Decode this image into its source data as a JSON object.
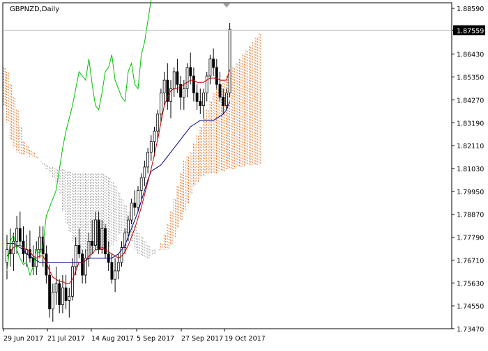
{
  "symbol_label": "GBPNZD,Daily",
  "current_price": "1.87559",
  "colors": {
    "background": "#ffffff",
    "frame": "#000000",
    "tenkan": "#c00000",
    "kijun": "#000080",
    "chikou": "#00c000",
    "cloud_bear": "#e07020",
    "cloud_bull": "#a0a0a0",
    "price_tag_bg": "#000000",
    "price_tag_fg": "#ffffff",
    "price_line": "#c0c0c0"
  },
  "chart_data": {
    "type": "candlestick",
    "title": "GBPNZD,Daily",
    "y_ticks": [
      "1.88590",
      "1.87559",
      "1.86430",
      "1.85350",
      "1.84270",
      "1.83190",
      "1.82110",
      "1.81030",
      "1.79950",
      "1.78870",
      "1.77790",
      "1.76710",
      "1.75630",
      "1.74550",
      "1.73470"
    ],
    "x_ticks": [
      "29 Jun 2017",
      "21 Jul 2017",
      "14 Aug 2017",
      "5 Sep 2017",
      "27 Sep 2017",
      "19 Oct 2017"
    ],
    "ylim": [
      1.7347,
      1.8859
    ],
    "price_step": 0.0108,
    "candles": [
      [
        1.766,
        1.779,
        1.758,
        1.772
      ],
      [
        1.772,
        1.782,
        1.764,
        1.77
      ],
      [
        1.77,
        1.78,
        1.762,
        1.776
      ],
      [
        1.776,
        1.788,
        1.77,
        1.782
      ],
      [
        1.782,
        1.79,
        1.774,
        1.776
      ],
      [
        1.776,
        1.783,
        1.766,
        1.77
      ],
      [
        1.77,
        1.779,
        1.764,
        1.772
      ],
      [
        1.772,
        1.781,
        1.766,
        1.768
      ],
      [
        1.768,
        1.774,
        1.76,
        1.764
      ],
      [
        1.764,
        1.776,
        1.76,
        1.772
      ],
      [
        1.772,
        1.783,
        1.768,
        1.778
      ],
      [
        1.778,
        1.783,
        1.764,
        1.77
      ],
      [
        1.77,
        1.774,
        1.756,
        1.76
      ],
      [
        1.76,
        1.765,
        1.74,
        1.744
      ],
      [
        1.744,
        1.756,
        1.738,
        1.752
      ],
      [
        1.752,
        1.764,
        1.746,
        1.756
      ],
      [
        1.756,
        1.758,
        1.742,
        1.746
      ],
      [
        1.746,
        1.76,
        1.742,
        1.754
      ],
      [
        1.754,
        1.76,
        1.744,
        1.748
      ],
      [
        1.748,
        1.754,
        1.74,
        1.75
      ],
      [
        1.75,
        1.768,
        1.748,
        1.764
      ],
      [
        1.764,
        1.778,
        1.76,
        1.774
      ],
      [
        1.774,
        1.782,
        1.768,
        1.77
      ],
      [
        1.77,
        1.772,
        1.756,
        1.76
      ],
      [
        1.76,
        1.772,
        1.756,
        1.768
      ],
      [
        1.768,
        1.78,
        1.764,
        1.776
      ],
      [
        1.776,
        1.786,
        1.77,
        1.774
      ],
      [
        1.774,
        1.79,
        1.772,
        1.786
      ],
      [
        1.786,
        1.79,
        1.77,
        1.772
      ],
      [
        1.772,
        1.786,
        1.77,
        1.782
      ],
      [
        1.782,
        1.784,
        1.768,
        1.77
      ],
      [
        1.77,
        1.776,
        1.762,
        1.766
      ],
      [
        1.766,
        1.77,
        1.756,
        1.758
      ],
      [
        1.758,
        1.768,
        1.752,
        1.762
      ],
      [
        1.762,
        1.77,
        1.758,
        1.766
      ],
      [
        1.766,
        1.776,
        1.764,
        1.773
      ],
      [
        1.773,
        1.782,
        1.77,
        1.78
      ],
      [
        1.78,
        1.788,
        1.776,
        1.786
      ],
      [
        1.786,
        1.796,
        1.784,
        1.794
      ],
      [
        1.794,
        1.8,
        1.788,
        1.792
      ],
      [
        1.792,
        1.802,
        1.79,
        1.8
      ],
      [
        1.8,
        1.808,
        1.796,
        1.806
      ],
      [
        1.806,
        1.814,
        1.802,
        1.811
      ],
      [
        1.811,
        1.82,
        1.808,
        1.818
      ],
      [
        1.818,
        1.826,
        1.814,
        1.823
      ],
      [
        1.823,
        1.83,
        1.816,
        1.828
      ],
      [
        1.828,
        1.838,
        1.824,
        1.836
      ],
      [
        1.836,
        1.848,
        1.832,
        1.846
      ],
      [
        1.846,
        1.856,
        1.84,
        1.852
      ],
      [
        1.852,
        1.86,
        1.838,
        1.842
      ],
      [
        1.842,
        1.852,
        1.834,
        1.848
      ],
      [
        1.848,
        1.858,
        1.844,
        1.856
      ],
      [
        1.856,
        1.862,
        1.846,
        1.85
      ],
      [
        1.85,
        1.854,
        1.838,
        1.844
      ],
      [
        1.844,
        1.852,
        1.838,
        1.848
      ],
      [
        1.848,
        1.86,
        1.844,
        1.858
      ],
      [
        1.858,
        1.865,
        1.85,
        1.854
      ],
      [
        1.854,
        1.858,
        1.842,
        1.846
      ],
      [
        1.846,
        1.85,
        1.838,
        1.842
      ],
      [
        1.842,
        1.848,
        1.836,
        1.84
      ],
      [
        1.84,
        1.848,
        1.834,
        1.846
      ],
      [
        1.846,
        1.856,
        1.842,
        1.854
      ],
      [
        1.854,
        1.864,
        1.85,
        1.862
      ],
      [
        1.862,
        1.867,
        1.854,
        1.858
      ],
      [
        1.858,
        1.862,
        1.848,
        1.85
      ],
      [
        1.85,
        1.856,
        1.842,
        1.844
      ],
      [
        1.844,
        1.848,
        1.836,
        1.84
      ],
      [
        1.84,
        1.848,
        1.838,
        1.846
      ],
      [
        1.846,
        1.879,
        1.844,
        1.876
      ]
    ],
    "tenkan": [
      1.769,
      1.771,
      1.773,
      1.774,
      1.774,
      1.773,
      1.772,
      1.771,
      1.769,
      1.768,
      1.769,
      1.769,
      1.766,
      1.762,
      1.759,
      1.758,
      1.757,
      1.757,
      1.756,
      1.756,
      1.758,
      1.762,
      1.766,
      1.766,
      1.767,
      1.769,
      1.77,
      1.772,
      1.772,
      1.773,
      1.772,
      1.771,
      1.77,
      1.769,
      1.768,
      1.769,
      1.771,
      1.774,
      1.778,
      1.782,
      1.787,
      1.792,
      1.798,
      1.804,
      1.81,
      1.817,
      1.824,
      1.832,
      1.84,
      1.844,
      1.847,
      1.848,
      1.848,
      1.849,
      1.85,
      1.851,
      1.852,
      1.852,
      1.851,
      1.851,
      1.851,
      1.852,
      1.853,
      1.853,
      1.853,
      1.852,
      1.852,
      1.852,
      1.857
    ],
    "kijun": [
      1.775,
      1.775,
      1.775,
      1.774,
      1.773,
      1.772,
      1.77,
      1.769,
      1.768,
      1.767,
      1.766,
      1.766,
      1.766,
      1.766,
      1.766,
      1.766,
      1.766,
      1.766,
      1.766,
      1.766,
      1.766,
      1.766,
      1.766,
      1.766,
      1.767,
      1.768,
      1.768,
      1.768,
      1.768,
      1.768,
      1.768,
      1.768,
      1.768,
      1.769,
      1.77,
      1.772,
      1.774,
      1.778,
      1.782,
      1.786,
      1.79,
      1.795,
      1.8,
      1.805,
      1.809,
      1.81,
      1.811,
      1.812,
      1.814,
      1.816,
      1.818,
      1.82,
      1.822,
      1.824,
      1.826,
      1.828,
      1.83,
      1.831,
      1.832,
      1.833,
      1.833,
      1.833,
      1.833,
      1.833,
      1.834,
      1.835,
      1.836,
      1.838,
      1.842
    ],
    "chikou": [
      1.762,
      1.776,
      1.779,
      1.772,
      1.768,
      1.765,
      1.766,
      1.76,
      1.764,
      1.772,
      1.77,
      1.774,
      1.788,
      1.792,
      1.796,
      1.8,
      1.81,
      1.82,
      1.828,
      1.834,
      1.84,
      1.848,
      1.856,
      1.854,
      1.852,
      1.862,
      1.85,
      1.84,
      1.838,
      1.846,
      1.856,
      1.858,
      1.864,
      1.852,
      1.848,
      1.844,
      1.842,
      1.856,
      1.86,
      1.85,
      1.848,
      1.864,
      1.87,
      1.88,
      1.89,
      1.9
    ],
    "cloud_span_a": [
      1.858,
      1.856,
      1.85,
      1.844,
      1.838,
      1.83,
      1.823,
      1.821,
      1.819,
      1.818,
      1.816,
      1.814,
      1.812,
      1.81,
      1.808,
      1.806,
      1.804,
      1.798,
      1.79,
      1.784,
      1.78,
      1.776,
      1.774,
      1.773,
      1.772,
      1.771,
      1.77,
      1.77,
      1.771,
      1.772,
      1.772,
      1.772,
      1.773,
      1.774,
      1.776,
      1.779,
      1.78,
      1.78,
      1.778,
      1.776,
      1.772,
      1.77,
      1.769,
      1.768,
      1.768,
      1.769,
      1.77,
      1.772,
      1.775,
      1.779,
      1.784,
      1.79,
      1.796,
      1.802,
      1.808,
      1.814,
      1.816,
      1.818,
      1.822,
      1.826,
      1.83,
      1.834,
      1.838,
      1.842,
      1.846,
      1.848,
      1.85,
      1.852,
      1.854,
      1.856,
      1.858,
      1.86,
      1.862,
      1.864,
      1.866,
      1.868,
      1.87,
      1.872,
      1.874
    ],
    "cloud_span_b": [
      1.84,
      1.832,
      1.824,
      1.82,
      1.818,
      1.817,
      1.817,
      1.817,
      1.816,
      1.816,
      1.815,
      1.814,
      1.813,
      1.812,
      1.811,
      1.811,
      1.81,
      1.81,
      1.81,
      1.809,
      1.809,
      1.808,
      1.808,
      1.808,
      1.808,
      1.808,
      1.808,
      1.808,
      1.808,
      1.808,
      1.808,
      1.807,
      1.806,
      1.804,
      1.802,
      1.799,
      1.796,
      1.793,
      1.79,
      1.786,
      1.783,
      1.78,
      1.778,
      1.776,
      1.774,
      1.772,
      1.772,
      1.772,
      1.772,
      1.772,
      1.772,
      1.774,
      1.778,
      1.782,
      1.786,
      1.79,
      1.794,
      1.798,
      1.802,
      1.804,
      1.806,
      1.807,
      1.808,
      1.808,
      1.808,
      1.808,
      1.809,
      1.809,
      1.81,
      1.81,
      1.81,
      1.811,
      1.811,
      1.811,
      1.812,
      1.812,
      1.812,
      1.812,
      1.812
    ]
  }
}
